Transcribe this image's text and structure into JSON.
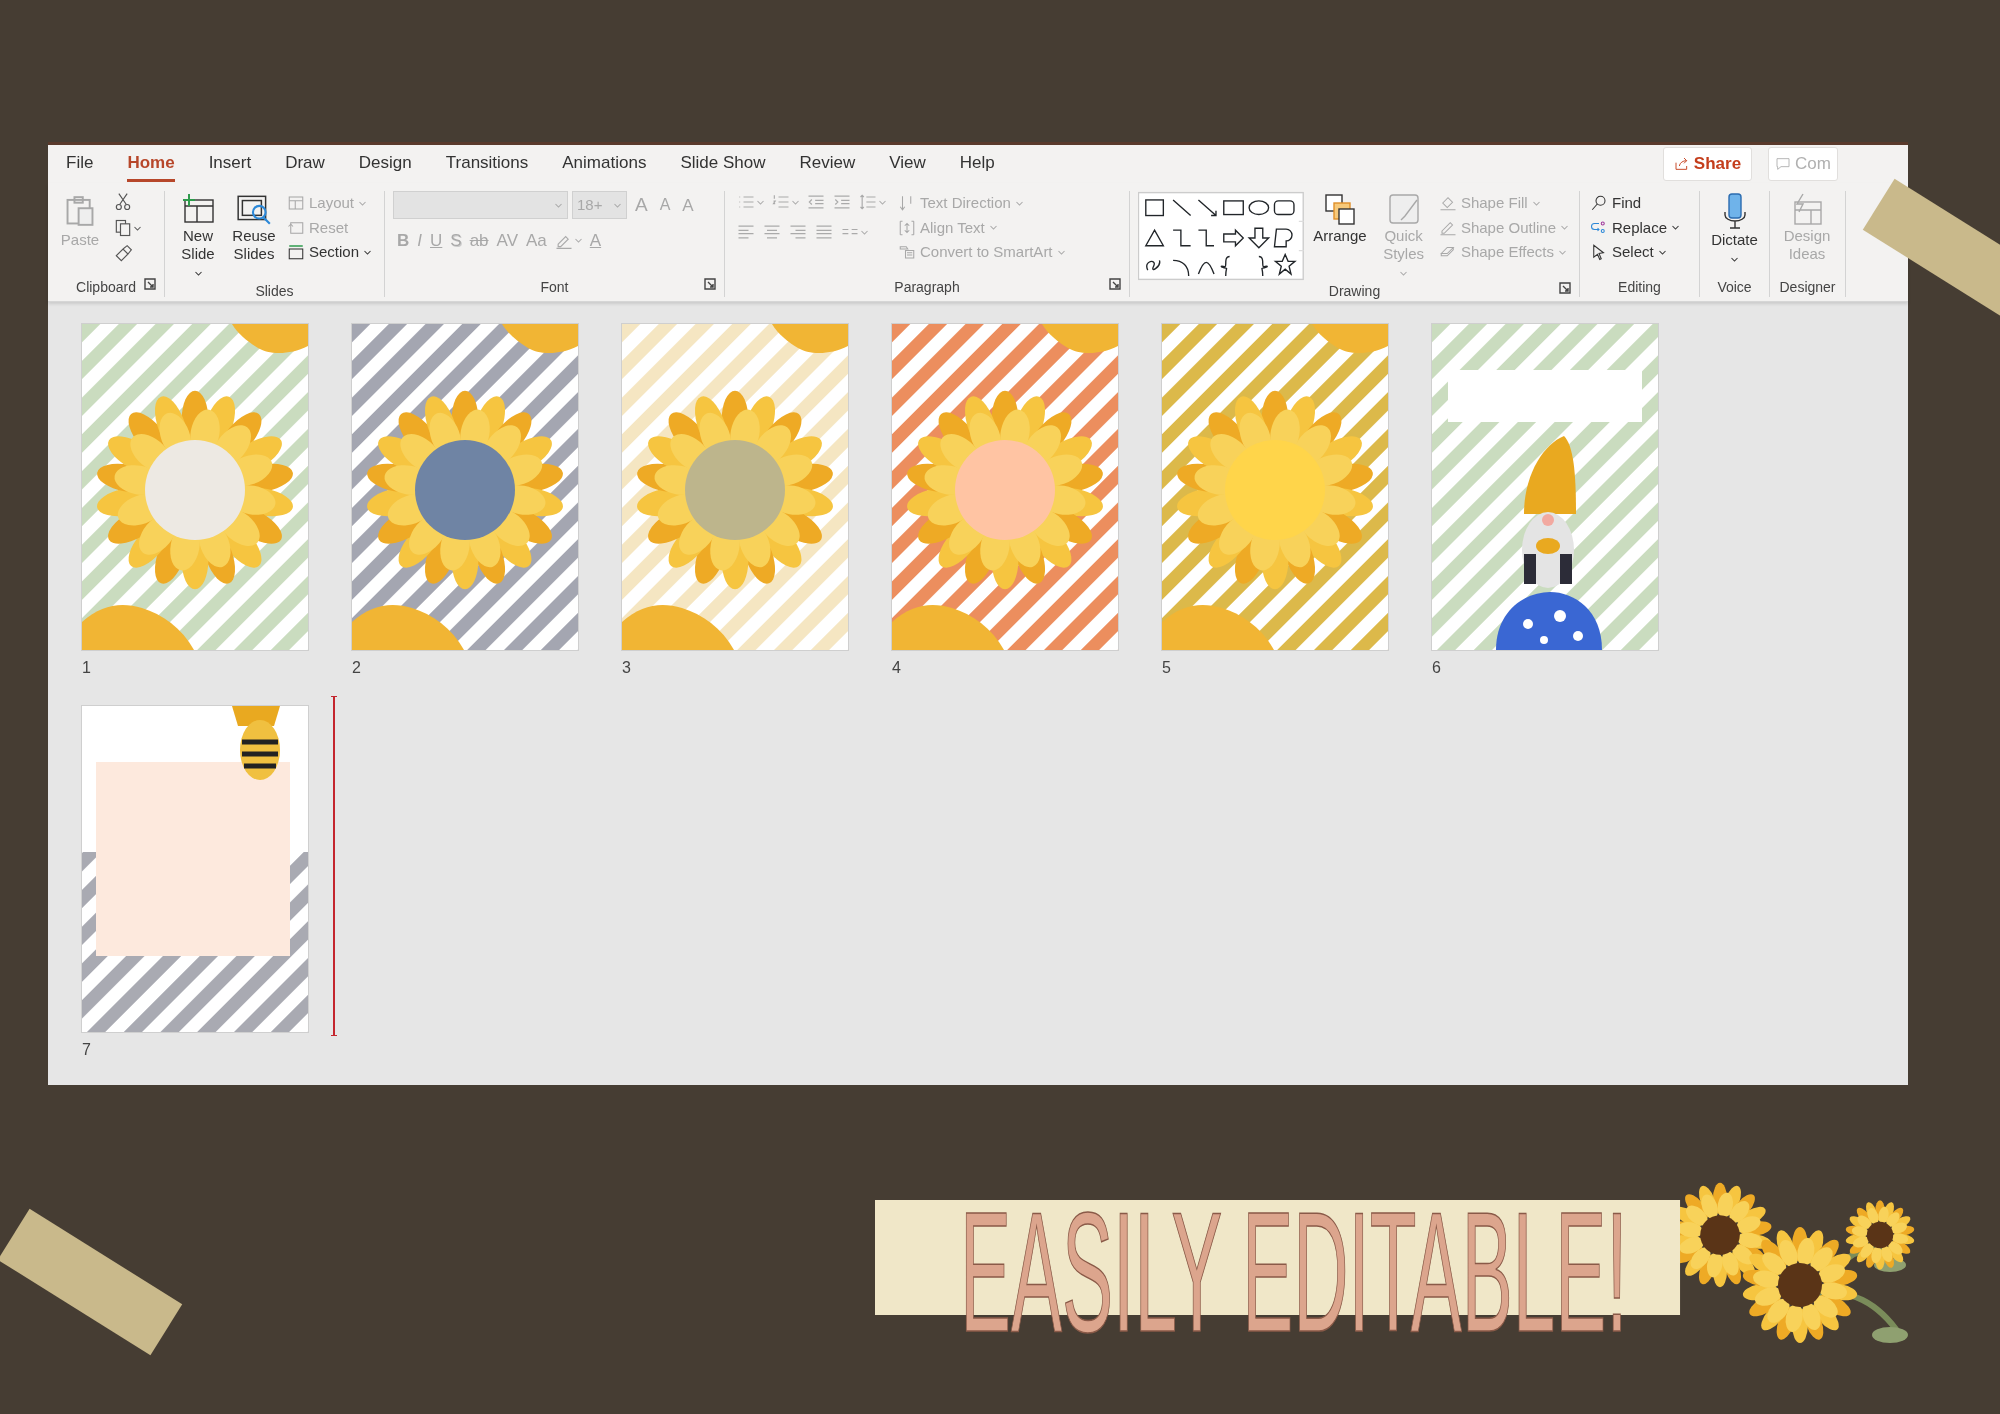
{
  "menu_tabs": [
    {
      "label": "File",
      "selected": false
    },
    {
      "label": "Home",
      "selected": true
    },
    {
      "label": "Insert",
      "selected": false
    },
    {
      "label": "Draw",
      "selected": false
    },
    {
      "label": "Design",
      "selected": false
    },
    {
      "label": "Transitions",
      "selected": false
    },
    {
      "label": "Animations",
      "selected": false
    },
    {
      "label": "Slide Show",
      "selected": false
    },
    {
      "label": "Review",
      "selected": false
    },
    {
      "label": "View",
      "selected": false
    },
    {
      "label": "Help",
      "selected": false
    }
  ],
  "share_button": "Share",
  "comments_button": "Com",
  "ribbon": {
    "clipboard": {
      "label": "Clipboard",
      "paste": {
        "label": "Paste",
        "disabled": true
      }
    },
    "slides": {
      "label": "Slides",
      "new_slide": {
        "label": "New Slide",
        "disabled": false
      },
      "reuse_slides": {
        "label": "Reuse Slides",
        "disabled": false
      },
      "layout": {
        "label": "Layout",
        "disabled": true
      },
      "reset": {
        "label": "Reset",
        "disabled": true
      },
      "section": {
        "label": "Section",
        "disabled": false
      }
    },
    "font": {
      "label": "Font",
      "disabled": true,
      "font_size": "18+",
      "size_buttons": [
        "A",
        "A"
      ],
      "clear_button": "A",
      "format_buttons": [
        "B",
        "I",
        "U",
        "S",
        "ab",
        "AV",
        "Aa"
      ],
      "font_color_button": "A"
    },
    "paragraph": {
      "label": "Paragraph",
      "disabled": true,
      "text_direction": "Text Direction",
      "align_text": "Align Text",
      "convert": "Convert to SmartArt"
    },
    "drawing": {
      "label": "Drawing",
      "arrange": {
        "label": "Arrange",
        "disabled": false
      },
      "quick_styles": {
        "label": "Quick Styles",
        "disabled": true
      },
      "shape_fill": {
        "label": "Shape Fill",
        "disabled": true
      },
      "shape_outline": {
        "label": "Shape Outline",
        "disabled": true
      },
      "shape_effects": {
        "label": "Shape Effects",
        "disabled": true
      }
    },
    "editing": {
      "label": "Editing",
      "find": "Find",
      "replace": "Replace",
      "select": "Select"
    },
    "voice": {
      "label": "Voice",
      "dictate": {
        "label": "Dictate",
        "disabled": false
      }
    },
    "designer": {
      "label": "Designer",
      "design_ideas": {
        "label": "Design Ideas",
        "disabled": true
      }
    }
  },
  "slides": [
    {
      "number": "1",
      "kind": "sunflower",
      "stripes": {
        "color": "#cadcbf"
      },
      "color": "#ede9e3"
    },
    {
      "number": "2",
      "kind": "sunflower",
      "stripes": {
        "color": "#a4a6b1"
      },
      "color": "#6f84a4"
    },
    {
      "number": "3",
      "kind": "sunflower",
      "stripes": {
        "color": "#f5e6c2"
      },
      "color": "#bdb58c"
    },
    {
      "number": "4",
      "kind": "sunflower",
      "stripes": {
        "color": "#ec8e5e"
      },
      "color": "#ffc4a3"
    },
    {
      "number": "5",
      "kind": "sunflower",
      "stripes": {
        "color": "#dcb94a"
      },
      "color": "#ffd54a"
    },
    {
      "number": "6",
      "kind": "gnome",
      "stripes": {
        "color": "#cadcbf"
      },
      "color": "#ffffff"
    },
    {
      "number": "7",
      "kind": "note",
      "stripes": {
        "color": "#a9aab2"
      },
      "color": "#fde9dd"
    }
  ],
  "banner": "EASILY EDITABLE!"
}
